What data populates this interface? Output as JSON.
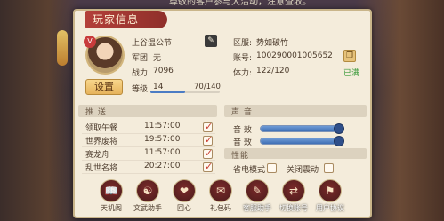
{
  "background_banner": "尊敬的客户参与大活动，注意查收。",
  "panel": {
    "title": "玩家信息",
    "setup_button": "设置",
    "name": "上谷温公节",
    "army_label": "军团:",
    "army_value": "无",
    "power_label": "战力:",
    "power_value": "7096",
    "level_label": "等级:",
    "level_value": "14",
    "exp_text": "70/140",
    "exp_fraction": 0.5,
    "server_label": "区服:",
    "server_value": "势如破竹",
    "account_label": "账号:",
    "account_value": "100290001005652",
    "stamina_label": "体力:",
    "stamina_value": "122/120",
    "stamina_status": "已满"
  },
  "push": {
    "title": "推 送",
    "items": [
      {
        "name": "领取午餐",
        "time": "11:57:00",
        "checked": true
      },
      {
        "name": "世界废将",
        "time": "19:57:00",
        "checked": true
      },
      {
        "name": "赛龙舟",
        "time": "11:57:00",
        "checked": true
      },
      {
        "name": "乱世名将",
        "time": "20:27:00",
        "checked": true
      }
    ]
  },
  "sound": {
    "title": "声 音",
    "sfx_label": "音 效",
    "sfx_level": 1.0,
    "music_label": "音 效",
    "music_level": 1.0
  },
  "performance": {
    "title": "性能",
    "power_saving_label": "省电模式",
    "power_saving_checked": false,
    "vibration_label": "关闭震动",
    "vibration_checked": false
  },
  "bottom_buttons": [
    {
      "label": "天机阁",
      "icon": "book-icon"
    },
    {
      "label": "文武助手",
      "icon": "helper-icon"
    },
    {
      "label": "回心",
      "icon": "heart-icon"
    },
    {
      "label": "礼包码",
      "icon": "gift-icon"
    },
    {
      "label": "客服助手",
      "icon": "chat-icon"
    },
    {
      "label": "切换账号",
      "icon": "switch-icon"
    },
    {
      "label": "用户协议",
      "icon": "shield-icon"
    }
  ]
}
